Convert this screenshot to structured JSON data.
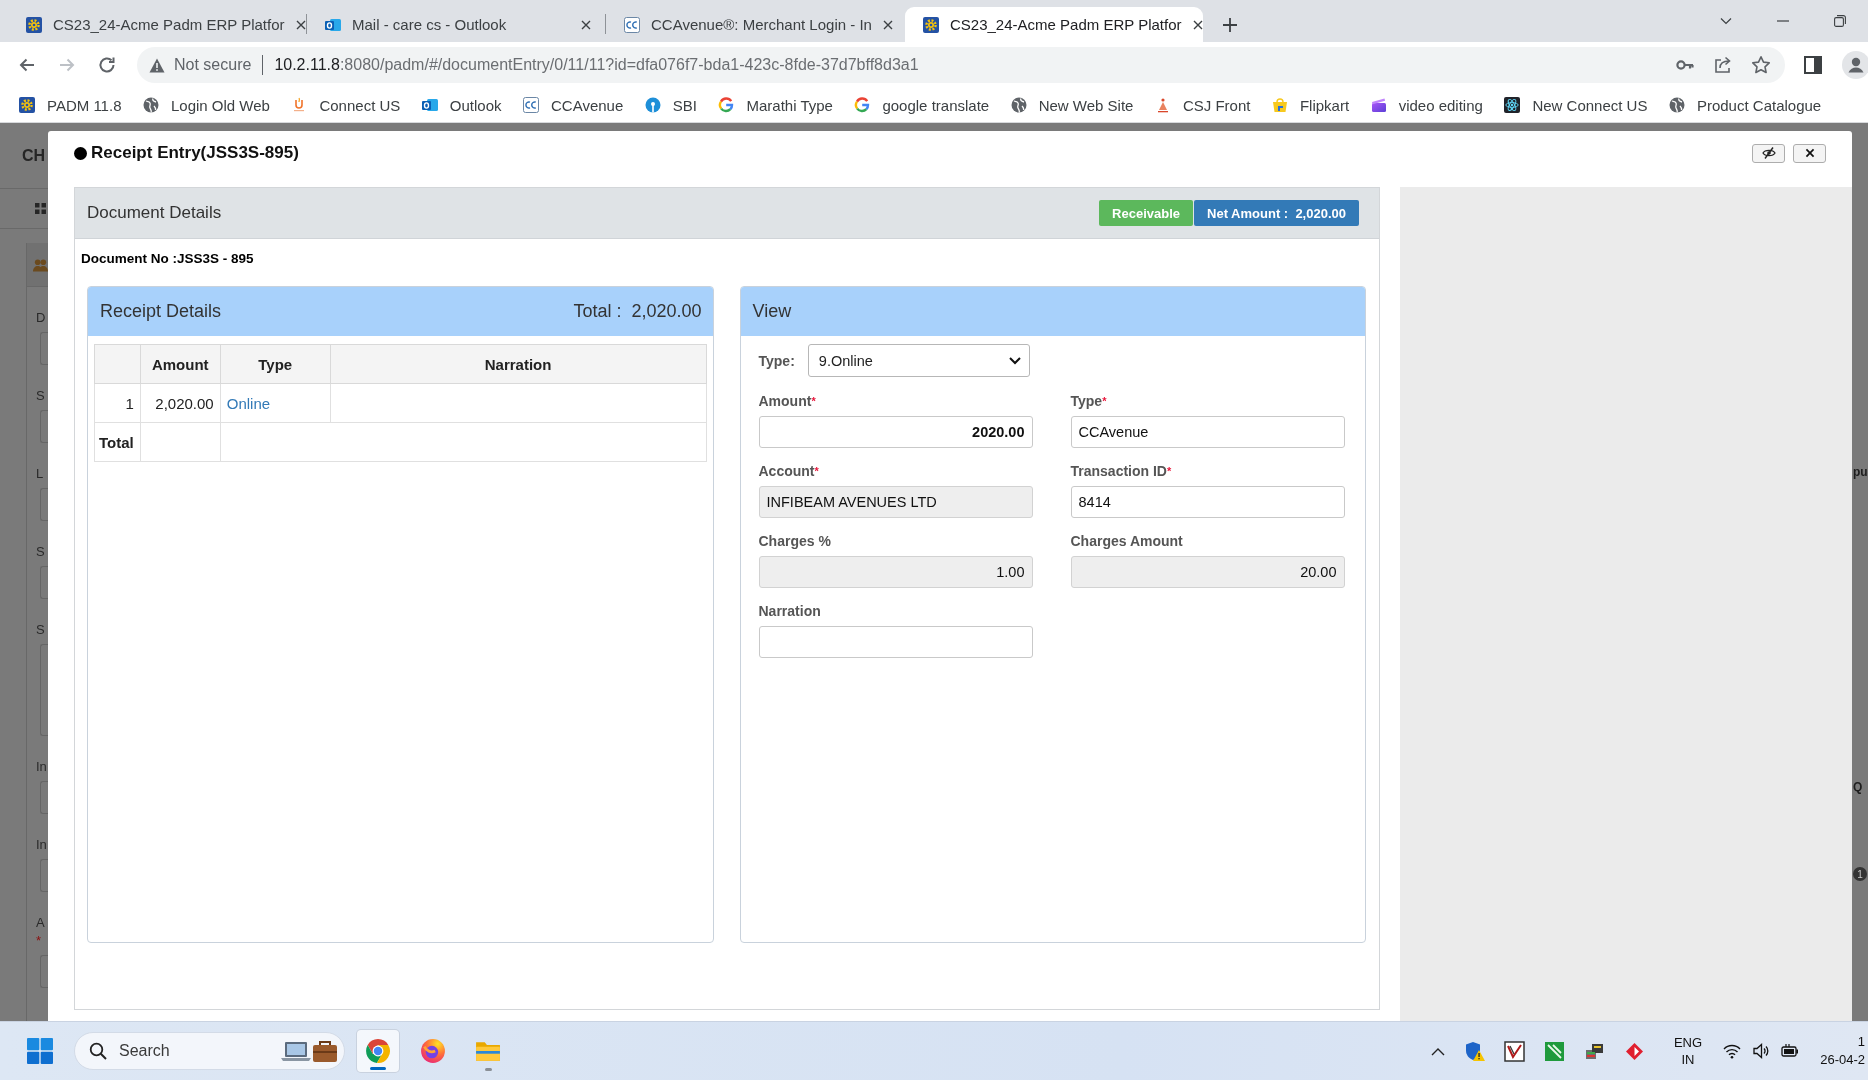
{
  "browser": {
    "tabs": [
      {
        "title": "CS23_24-Acme Padm ERP Platfor",
        "kind": "padm",
        "selected": false
      },
      {
        "title": "Mail - care cs - Outlook",
        "kind": "outlook",
        "selected": false
      },
      {
        "title": "CCAvenue®: Merchant Login - In",
        "kind": "cc",
        "selected": false
      },
      {
        "title": "CS23_24-Acme Padm ERP Platfor",
        "kind": "padm",
        "selected": true
      }
    ],
    "address": {
      "security": "Not secure",
      "host": "10.2.11.8",
      "path": ":8080/padm/#/documentEntry/0/11/11?id=dfa076f7-bda1-423c-8fde-37d7bff8d3a1"
    },
    "bookmarks": [
      {
        "label": "PADM 11.8",
        "kind": "padm"
      },
      {
        "label": "Login Old Web",
        "kind": "globe"
      },
      {
        "label": "Connect US",
        "kind": "connect"
      },
      {
        "label": "Outlook",
        "kind": "outlook"
      },
      {
        "label": "CCAvenue",
        "kind": "cc"
      },
      {
        "label": "SBI",
        "kind": "sbi"
      },
      {
        "label": "Marathi Type",
        "kind": "google"
      },
      {
        "label": "google translate",
        "kind": "google"
      },
      {
        "label": "New Web Site",
        "kind": "globe"
      },
      {
        "label": "CSJ Front",
        "kind": "csj"
      },
      {
        "label": "Flipkart",
        "kind": "flipkart"
      },
      {
        "label": "video editing",
        "kind": "video"
      },
      {
        "label": "New Connect US",
        "kind": "react"
      },
      {
        "label": "Product Catalogue",
        "kind": "globe"
      }
    ]
  },
  "background": {
    "heading": "CH",
    "left_fields": [
      {
        "label": "D",
        "kind": "input"
      },
      {
        "label": "S",
        "kind": "input"
      },
      {
        "label": "L",
        "kind": "input"
      },
      {
        "label": "S",
        "kind": "input"
      },
      {
        "label": "S",
        "kind": "textarea"
      },
      {
        "label": "In",
        "kind": "input"
      },
      {
        "label": "In",
        "kind": "input"
      },
      {
        "label": "A",
        "required_mark": "*",
        "kind": "input"
      }
    ],
    "right_texts": [
      "pu",
      "Q"
    ],
    "right_badge": "1"
  },
  "modal": {
    "title": "Receipt Entry(JSS3S-895)",
    "document": {
      "title": "Document Details",
      "badges": [
        {
          "label": "Receivable",
          "color": "#5cb85c"
        },
        {
          "label": "Net Amount :  2,020.00",
          "color": "#337ab7"
        }
      ],
      "document_no": "Document No :JSS3S - 895"
    },
    "receipt": {
      "title": "Receipt Details",
      "total": "Total :  2,020.00",
      "columns": [
        "Amount",
        "Type",
        "Narration"
      ],
      "rows": [
        {
          "index": "1",
          "amount": "2,020.00",
          "type": "Online"
        }
      ],
      "footer": "Total"
    },
    "view": {
      "title": "View",
      "type_label": "Type:",
      "type_value": "9.Online",
      "fields": [
        {
          "label": "Amount",
          "required_mark": "*",
          "value": "2020.00",
          "kind": "amount",
          "readonly": false
        },
        {
          "label": "Type",
          "required_mark": "*",
          "value": "CCAvenue",
          "kind": "text",
          "readonly": false
        },
        {
          "label": "Account",
          "required_mark": "*",
          "value": "INFIBEAM AVENUES LTD",
          "kind": "text",
          "readonly": true
        },
        {
          "label": "Transaction ID",
          "required_mark": "*",
          "value": "8414",
          "kind": "text",
          "readonly": false
        },
        {
          "label": "Charges %",
          "value": "1.00",
          "kind": "number",
          "readonly": true
        },
        {
          "label": "Charges Amount",
          "value": "20.00",
          "kind": "number",
          "readonly": true
        },
        {
          "label": "Narration",
          "kind": "text",
          "readonly": false
        }
      ]
    }
  },
  "taskbar": {
    "search": {
      "placeholder": "Search"
    },
    "apps": [
      {
        "kind": "chrome",
        "selected": true,
        "running": true
      },
      {
        "kind": "firefox",
        "selected": false,
        "running": false
      },
      {
        "kind": "files",
        "selected": false,
        "running": true
      }
    ],
    "tray": {
      "language": "ENG",
      "region": "IN",
      "time": "1",
      "date": "26-04-2"
    }
  }
}
